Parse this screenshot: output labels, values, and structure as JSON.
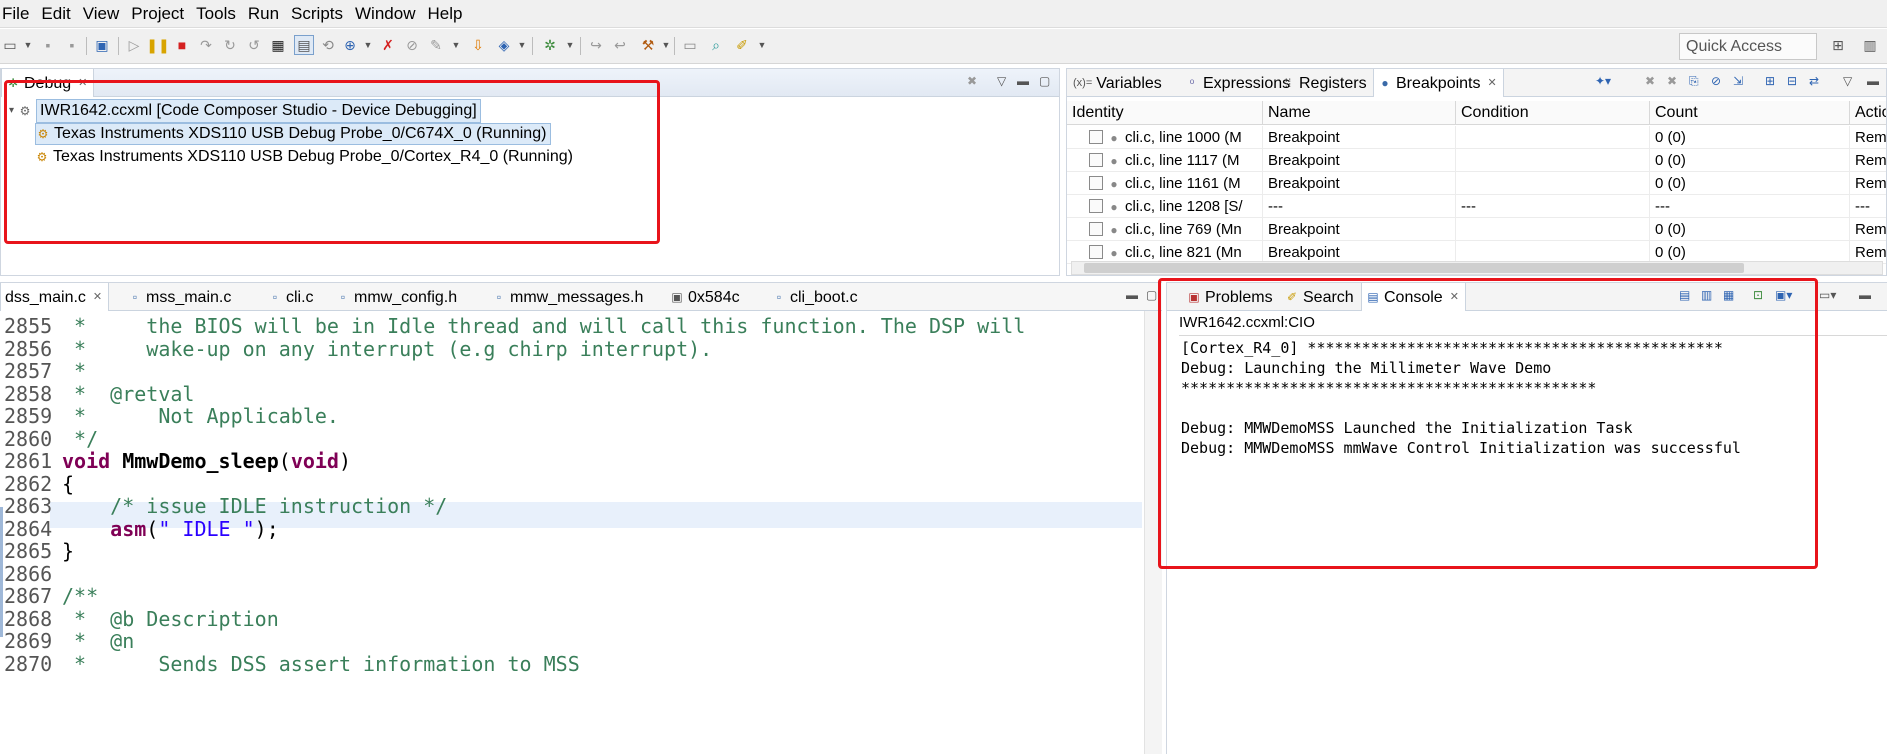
{
  "menu": [
    "File",
    "Edit",
    "View",
    "Project",
    "Tools",
    "Run",
    "Scripts",
    "Window",
    "Help"
  ],
  "toolbar": {
    "quick_access": "Quick Access"
  },
  "debug_view": {
    "tab_label": "Debug",
    "root": "IWR1642.ccxml [Code Composer Studio - Device Debugging]",
    "cores": [
      "Texas Instruments XDS110 USB Debug Probe_0/C674X_0 (Running)",
      "Texas Instruments XDS110 USB Debug Probe_0/Cortex_R4_0 (Running)"
    ]
  },
  "right_top_tabs": [
    "Variables",
    "Expressions",
    "Registers",
    "Breakpoints"
  ],
  "right_top_tab_prefix": "(x)=",
  "breakpoints": {
    "columns": [
      "Identity",
      "Name",
      "Condition",
      "Count",
      "Actio"
    ],
    "rows": [
      {
        "identity": "cli.c, line 1000 (M",
        "name": "Breakpoint",
        "condition": "",
        "count": "0 (0)",
        "action": "Rema"
      },
      {
        "identity": "cli.c, line 1117 (M",
        "name": "Breakpoint",
        "condition": "",
        "count": "0 (0)",
        "action": "Rema"
      },
      {
        "identity": "cli.c, line 1161 (M",
        "name": "Breakpoint",
        "condition": "",
        "count": "0 (0)",
        "action": "Rema"
      },
      {
        "identity": "cli.c, line 1208 [S/",
        "name": "---",
        "condition": "---",
        "count": "---",
        "action": "---"
      },
      {
        "identity": "cli.c, line 769 (Mn",
        "name": "Breakpoint",
        "condition": "",
        "count": "0 (0)",
        "action": "Rema"
      },
      {
        "identity": "cli.c, line 821 (Mn",
        "name": "Breakpoint",
        "condition": "",
        "count": "0 (0)",
        "action": "Rema"
      }
    ]
  },
  "editor": {
    "tabs": [
      "dss_main.c",
      "mss_main.c",
      "cli.c",
      "mmw_config.h",
      "mmw_messages.h",
      "0x584c",
      "cli_boot.c"
    ],
    "lines": [
      {
        "n": "2855",
        "parts": [
          {
            "t": " *     the BIOS will be in Idle thread and will call this function. The DSP will",
            "c": "cm"
          }
        ]
      },
      {
        "n": "2856",
        "parts": [
          {
            "t": " *     wake-up on any interrupt (e.g chirp interrupt).",
            "c": "cm"
          }
        ]
      },
      {
        "n": "2857",
        "parts": [
          {
            "t": " *",
            "c": "cm"
          }
        ]
      },
      {
        "n": "2858",
        "parts": [
          {
            "t": " *  @retval",
            "c": "cm"
          }
        ]
      },
      {
        "n": "2859",
        "parts": [
          {
            "t": " *      Not Applicable.",
            "c": "cm"
          }
        ]
      },
      {
        "n": "2860",
        "parts": [
          {
            "t": " */",
            "c": "cm"
          }
        ]
      },
      {
        "n": "2861",
        "parts": [
          {
            "t": "void",
            "c": "kw"
          },
          {
            "t": " ",
            "c": ""
          },
          {
            "t": "MmwDemo_sleep",
            "c": "fn"
          },
          {
            "t": "(",
            "c": ""
          },
          {
            "t": "void",
            "c": "kw"
          },
          {
            "t": ")",
            "c": ""
          }
        ]
      },
      {
        "n": "2862",
        "parts": [
          {
            "t": "{",
            "c": ""
          }
        ]
      },
      {
        "n": "2863",
        "parts": [
          {
            "t": "    /* issue IDLE instruction */",
            "c": "cm"
          }
        ]
      },
      {
        "n": "2864",
        "parts": [
          {
            "t": "    ",
            "c": ""
          },
          {
            "t": "asm",
            "c": "kw"
          },
          {
            "t": "(",
            "c": ""
          },
          {
            "t": "\" IDLE \"",
            "c": "str"
          },
          {
            "t": ");",
            "c": ""
          }
        ]
      },
      {
        "n": "2865",
        "parts": [
          {
            "t": "}",
            "c": ""
          }
        ]
      },
      {
        "n": "2866",
        "parts": [
          {
            "t": "",
            "c": ""
          }
        ]
      },
      {
        "n": "2867",
        "parts": [
          {
            "t": "/**",
            "c": "cm"
          }
        ]
      },
      {
        "n": "2868",
        "parts": [
          {
            "t": " *  @b Description",
            "c": "cm"
          }
        ]
      },
      {
        "n": "2869",
        "parts": [
          {
            "t": " *  @n",
            "c": "cm"
          }
        ]
      },
      {
        "n": "2870",
        "parts": [
          {
            "t": " *      Sends DSS assert information to MSS",
            "c": "cm"
          }
        ]
      }
    ]
  },
  "console_view": {
    "tabs": [
      "Problems",
      "Search",
      "Console"
    ],
    "header": "IWR1642.ccxml:CIO",
    "lines": [
      "[Cortex_R4_0] **********************************************",
      "Debug: Launching the Millimeter Wave Demo",
      "**********************************************",
      "",
      "Debug: MMWDemoMSS Launched the Initialization Task",
      "Debug: MMWDemoMSS mmWave Control Initialization was successful"
    ]
  },
  "colors": {
    "highlight_box": "#e8141b",
    "selection": "#dceaf8",
    "comment": "#3a7f5a",
    "keyword": "#7f0055",
    "string": "#2a00ff"
  }
}
